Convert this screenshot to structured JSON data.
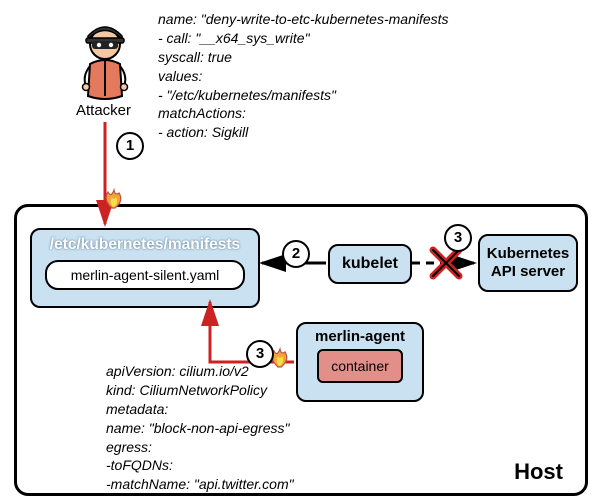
{
  "attacker": {
    "label": "Attacker"
  },
  "host": {
    "label": "Host"
  },
  "manifests": {
    "path": "/etc/kubernetes/manifests",
    "file": "merlin-agent-silent.yaml"
  },
  "kubelet": {
    "label": "kubelet"
  },
  "apiserver": {
    "label": "Kubernetes API server"
  },
  "merlin": {
    "title": "merlin-agent",
    "container": "container"
  },
  "callouts": {
    "c1": "1",
    "c2": "2",
    "c3a": "3",
    "c3b": "3"
  },
  "policy1": {
    "l1": "name: \"deny-write-to-etc-kubernetes-manifests",
    "l2": "- call: \"__x64_sys_write\"",
    "l3": "syscall: true",
    "l4": "  values:",
    "l5": "  - \"/etc/kubernetes/manifests\"",
    "l6": "matchActions:",
    "l7": "- action: Sigkill"
  },
  "policy2": {
    "l1": "apiVersion: cilium.io/v2",
    "l2": "kind: CiliumNetworkPolicy",
    "l3": "metadata:",
    "l4": "name: \"block-non-api-egress\"",
    "l5": "egress:",
    "l6": "-toFQDNs:",
    "l7": "-matchName: \"api.twitter.com\""
  }
}
